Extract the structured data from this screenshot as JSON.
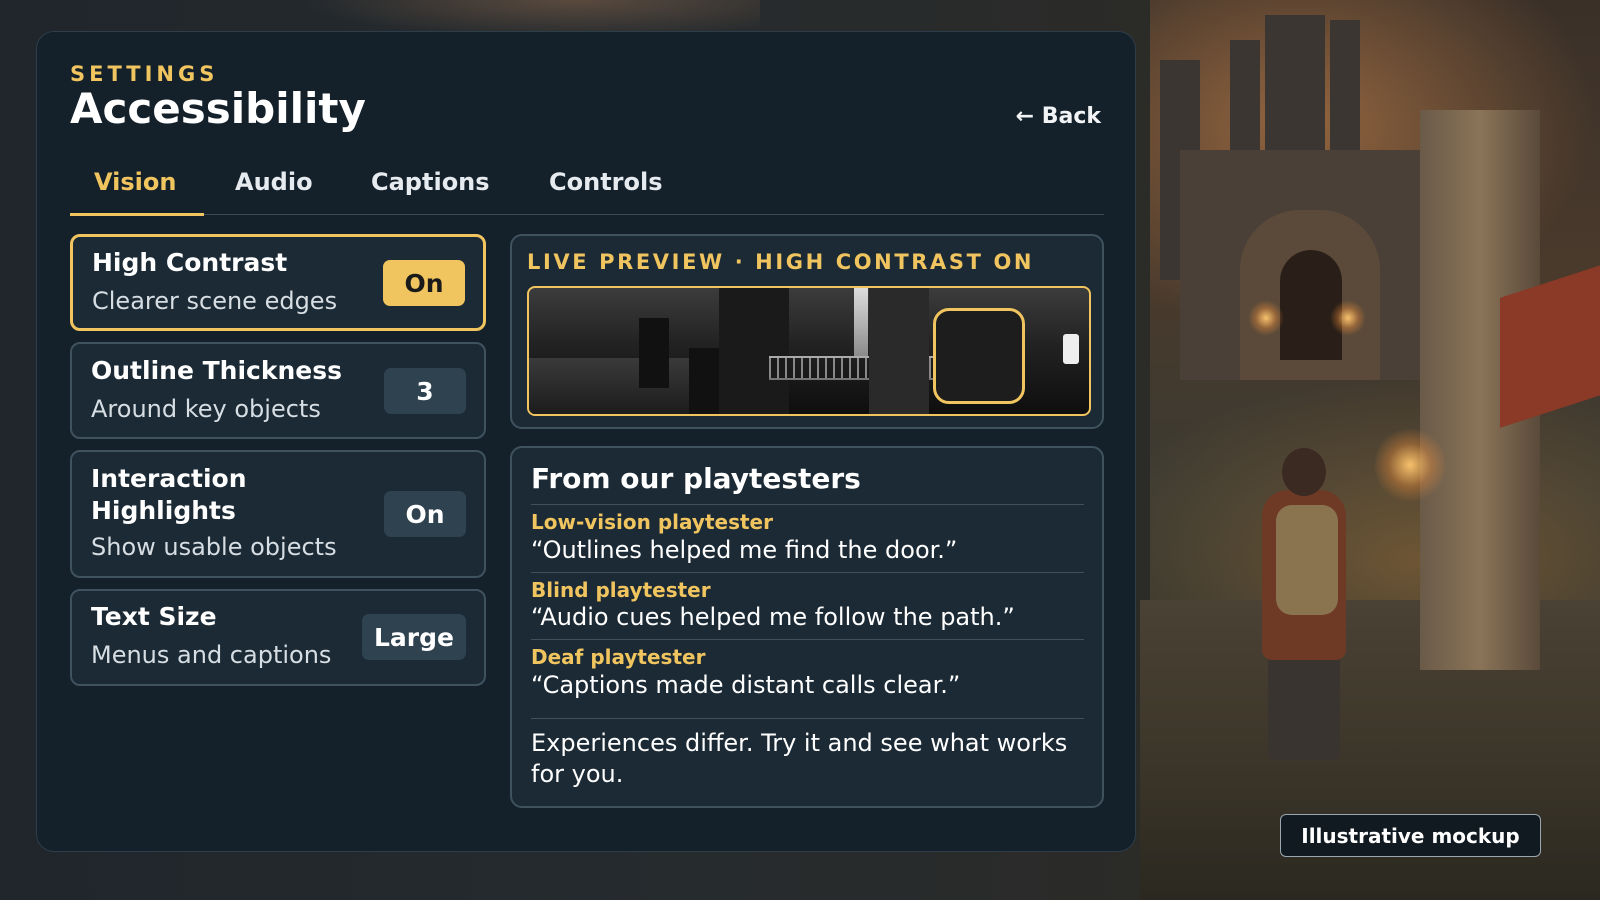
{
  "header": {
    "eyebrow": "SETTINGS",
    "title": "Accessibility",
    "back_label": "← Back"
  },
  "tabs": [
    {
      "label": "Vision",
      "active": true
    },
    {
      "label": "Audio",
      "active": false
    },
    {
      "label": "Captions",
      "active": false
    },
    {
      "label": "Controls",
      "active": false
    }
  ],
  "settings": [
    {
      "label": "High Contrast",
      "sub": "Clearer scene edges",
      "value": "On",
      "selected": true
    },
    {
      "label": "Outline Thickness",
      "sub": "Around key objects",
      "value": "3",
      "selected": false
    },
    {
      "label_line1": "Interaction",
      "label_line2": "Highlights",
      "sub": "Show usable objects",
      "value": "On",
      "selected": false
    },
    {
      "label": "Text Size",
      "sub": "Menus and captions",
      "value": "Large",
      "selected": false
    }
  ],
  "preview": {
    "title": "LIVE PREVIEW · HIGH CONTRAST ON"
  },
  "testimonials": {
    "title": "From our playtesters",
    "items": [
      {
        "author": "Low-vision playtester",
        "quote": "“Outlines helped me find the door.”"
      },
      {
        "author": "Blind playtester",
        "quote": "“Audio cues helped me follow the path.”"
      },
      {
        "author": "Deaf playtester",
        "quote": "“Captions made distant calls clear.”"
      }
    ],
    "note": "Experiences differ. Try it and see what works for you."
  },
  "mockup_tag": "Illustrative mockup",
  "colors": {
    "accent": "#f0c45e",
    "panel": "#14202a",
    "card": "#1b2a35",
    "card_border": "#41525f",
    "value_chip": "#2f4250"
  }
}
